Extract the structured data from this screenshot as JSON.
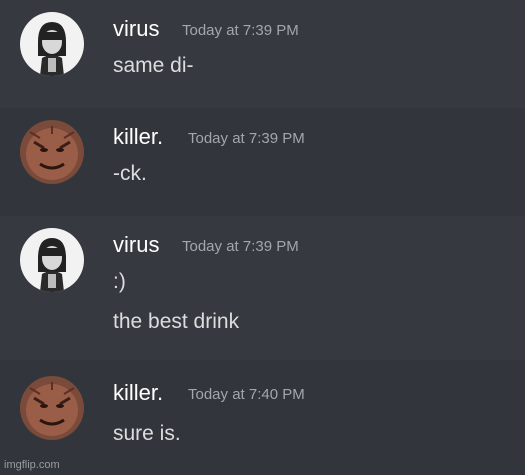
{
  "messages": [
    {
      "author": "virus",
      "timestamp": "Today at 7:39 PM",
      "avatar_icon": "virus-avatar-icon",
      "lines": [
        "same di-"
      ]
    },
    {
      "author": "killer.",
      "timestamp": "Today at 7:39 PM",
      "avatar_icon": "killer-avatar-icon",
      "lines": [
        "-ck."
      ]
    },
    {
      "author": "virus",
      "timestamp": "Today at 7:39 PM",
      "avatar_icon": "virus-avatar-icon",
      "lines": [
        ":)",
        "the best drink"
      ]
    },
    {
      "author": "killer.",
      "timestamp": "Today at 7:40 PM",
      "avatar_icon": "killer-avatar-icon",
      "lines": [
        "sure is."
      ]
    }
  ],
  "watermark": "imgflip.com",
  "colors": {
    "background": "#36393f",
    "alt_band": "#32353b",
    "username": "#ffffff",
    "timestamp": "#a3a6aa",
    "message_text": "#dcddde"
  }
}
